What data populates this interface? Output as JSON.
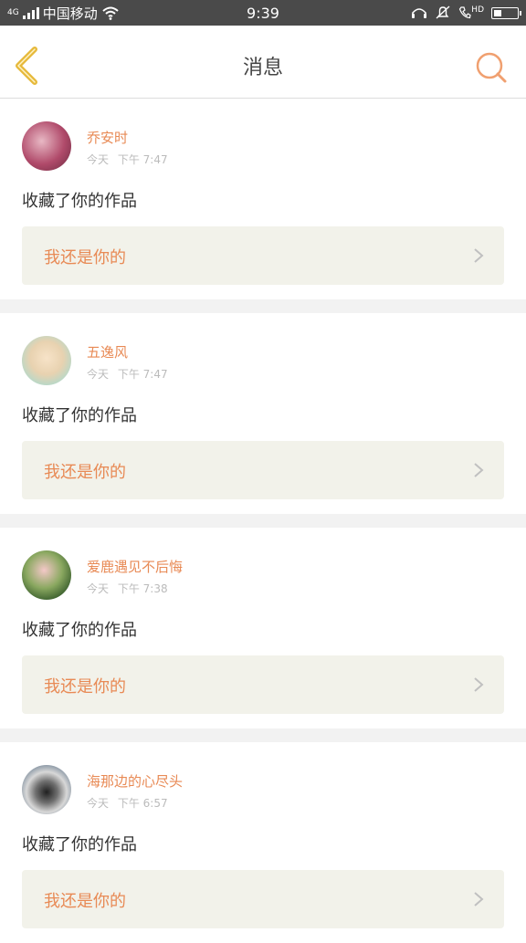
{
  "statusbar": {
    "carrier": "中国移动",
    "network": "4G",
    "time": "9:39",
    "hd": "HD"
  },
  "header": {
    "title": "消息"
  },
  "messages": [
    {
      "username": "乔安时",
      "label": "今天",
      "time": "下午 7:47",
      "text": "收藏了你的作品",
      "ref_title": "我还是你的"
    },
    {
      "username": "五逸风",
      "label": "今天",
      "time": "下午 7:47",
      "text": "收藏了你的作品",
      "ref_title": "我还是你的"
    },
    {
      "username": "爱鹿遇见不后悔",
      "label": "今天",
      "time": "下午 7:38",
      "text": "收藏了你的作品",
      "ref_title": "我还是你的"
    },
    {
      "username": "海那边的心尽头",
      "label": "今天",
      "time": "下午 6:57",
      "text": "收藏了你的作品",
      "ref_title": "我还是你的"
    }
  ],
  "colors": {
    "accent": "#e88a55",
    "back_chevron": "#e6b93a",
    "statusbar_bg": "#4a4a4a"
  }
}
